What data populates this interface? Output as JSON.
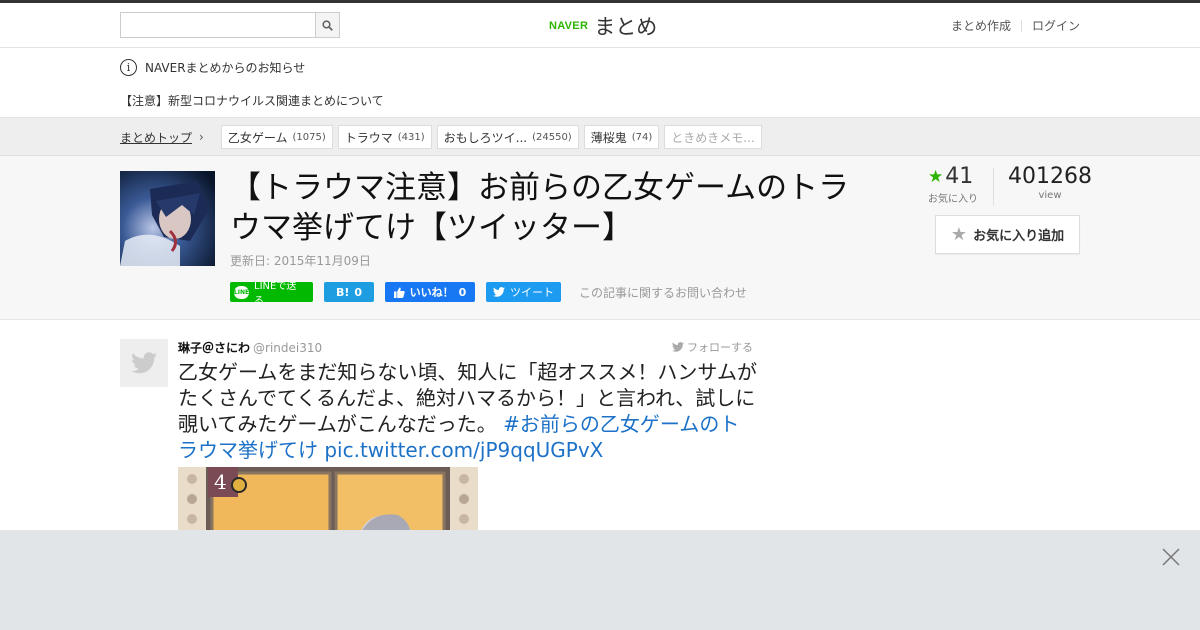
{
  "header": {
    "search": {
      "placeholder": "",
      "value": ""
    },
    "logo": {
      "brand": "NAVER",
      "name": "まとめ"
    },
    "links": {
      "create": "まとめ作成",
      "login": "ログイン"
    }
  },
  "notice": {
    "heading": "NAVERまとめからのお知らせ",
    "link": "【注意】新型コロナウイルス関連まとめについて"
  },
  "breadcrumb": {
    "top": "まとめトップ",
    "tags": [
      {
        "label": "乙女ゲーム",
        "count": "(1075)"
      },
      {
        "label": "トラウマ",
        "count": "(431)"
      },
      {
        "label": "おもしろツイ...",
        "count": "(24550)"
      },
      {
        "label": "薄桜鬼",
        "count": "(74)"
      },
      {
        "label": "ときめきメモ...",
        "count": ""
      }
    ]
  },
  "article": {
    "title": "【トラウマ注意】お前らの乙女ゲームのトラウマ挙げてけ【ツイッター】",
    "updated": "更新日: 2015年11月09日",
    "favorites": "41",
    "favorites_label": "お気に入り",
    "views": "401268",
    "views_label": "view",
    "fav_button": "お気に入り追加",
    "share": {
      "line": "LINEで送る",
      "line_icon": "LINE",
      "hatena_icon": "B!",
      "hatena_count": "0",
      "fb_label": "いいね！",
      "fb_count": "0",
      "tweet": "ツイート"
    },
    "inquiry": "この記事に関するお問い合わせ"
  },
  "tweet": {
    "name": "琳子＠さにわ",
    "handle": "@rindei310",
    "follow": "フォローする",
    "text": "乙女ゲームをまだ知らない頃、知人に「超オススメ！ハンサムがたくさんでてくるんだよ、絶対ハマるから！」と言われ、試しに覗いてみたゲームがこんなだった。",
    "hashtag": "#お前らの乙女ゲームのトラウマ挙げてけ",
    "link": "pic.twitter.com/jP9qqUGPvX",
    "image_badge": "4"
  },
  "colors": {
    "naver_green": "#2db400",
    "link_blue": "#1d72c8",
    "line_green": "#00b900",
    "overlay": "#e2e5e8"
  }
}
